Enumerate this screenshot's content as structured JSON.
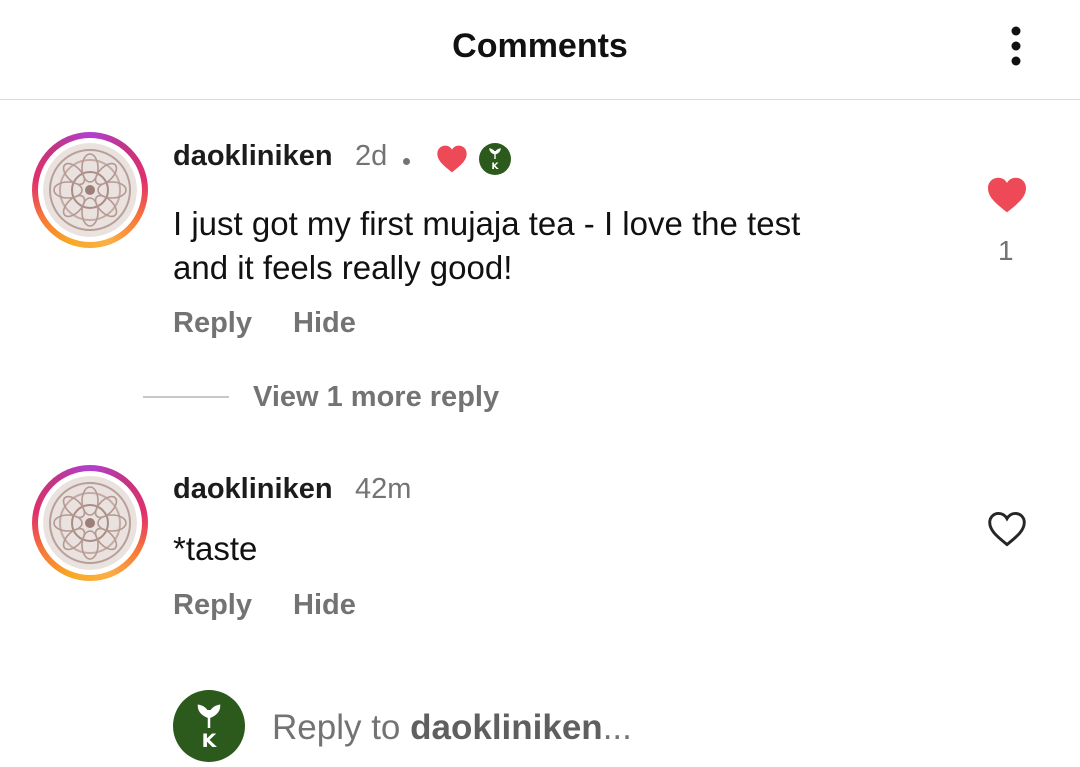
{
  "header": {
    "title": "Comments",
    "more_icon": "more-vertical-icon"
  },
  "comments": [
    {
      "username": "daokliniken",
      "time": "2d",
      "author_liked_icon": "heart-filled-icon",
      "author_avatar_icon": "brand-leaf-k-icon",
      "lines": [
        "I just got my first mujaja tea - I love the test",
        "and it feels really good!"
      ],
      "reply_label": "Reply",
      "hide_label": "Hide",
      "liked": true,
      "like_count": "1"
    },
    {
      "username": "daokliniken",
      "time": "42m",
      "text": "*taste",
      "reply_label": "Reply",
      "hide_label": "Hide",
      "liked": false
    }
  ],
  "view_more_replies": "View 1 more reply",
  "composer": {
    "prefix": "Reply to ",
    "username": "daokliniken",
    "suffix": "..."
  },
  "colors": {
    "like_red": "#ed4956",
    "brand_green": "#2b5a1c",
    "muted_text": "#737373"
  }
}
